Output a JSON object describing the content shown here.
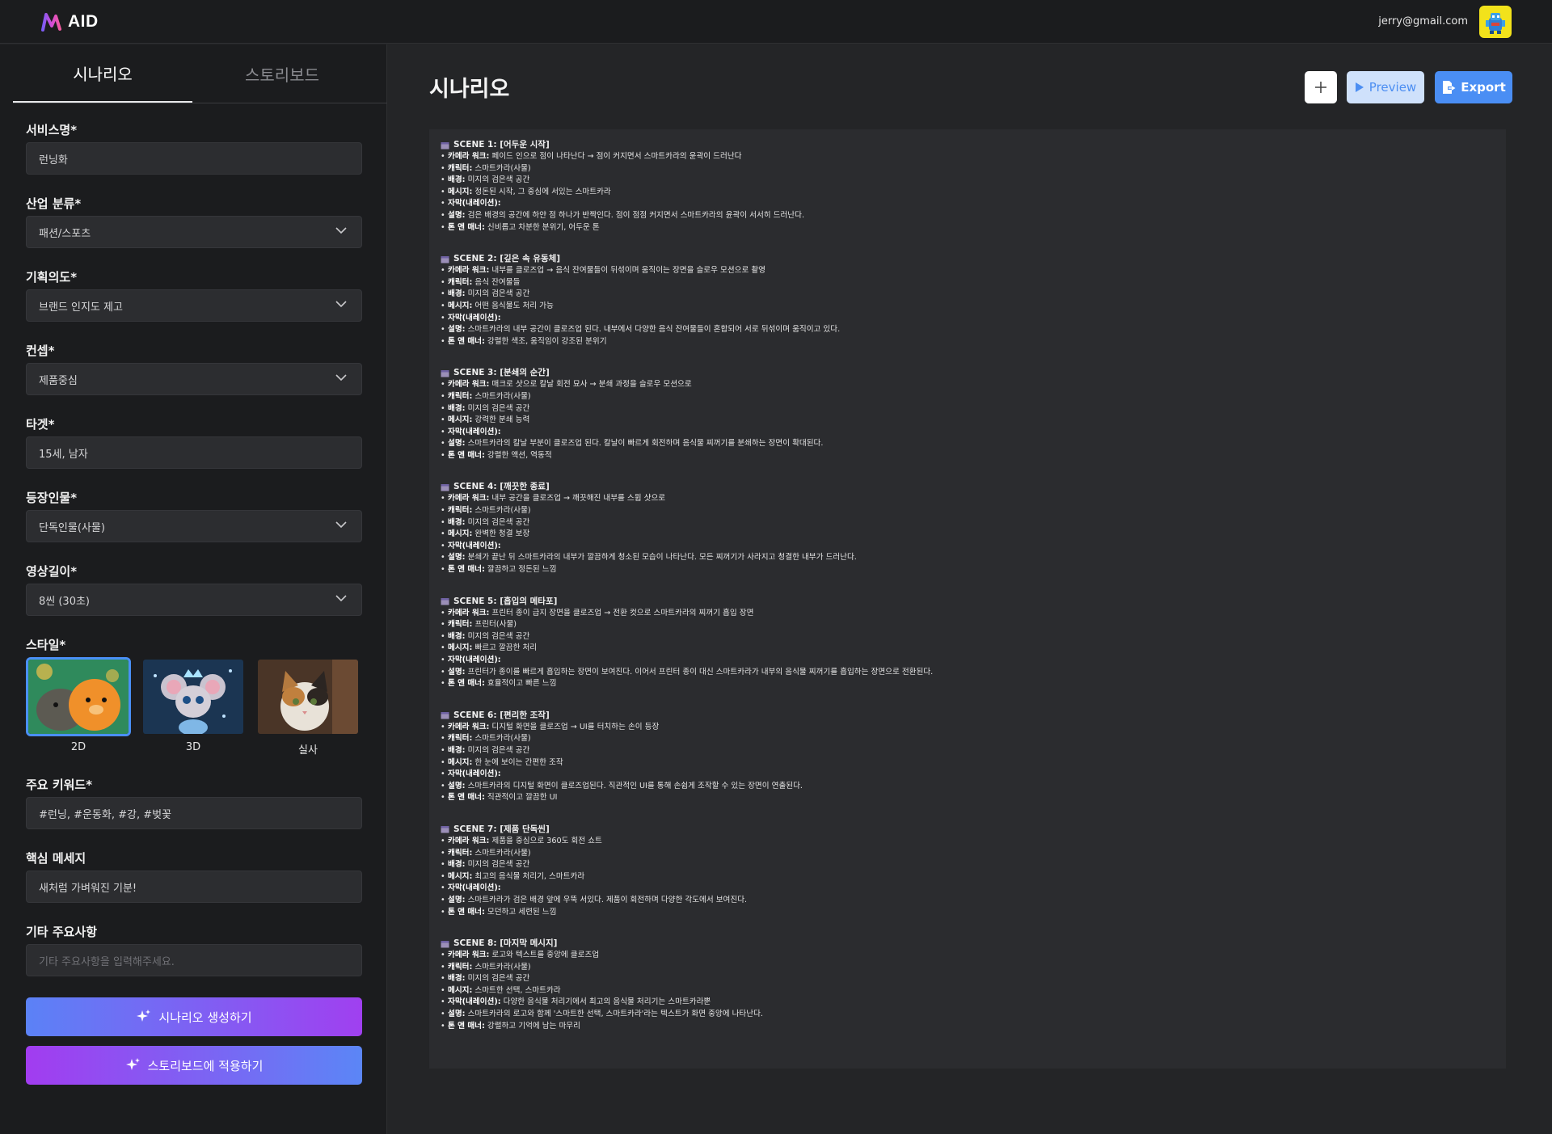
{
  "app": {
    "logo_text": "AID"
  },
  "user": {
    "email": "jerry@gmail.com"
  },
  "sidebar": {
    "tabs": [
      {
        "label": "시나리오"
      },
      {
        "label": "스토리보드"
      }
    ],
    "fields": {
      "service_name": {
        "label": "서비스명*",
        "value": "런닝화"
      },
      "industry": {
        "label": "산업 분류*",
        "value": "패션/스포츠"
      },
      "intent": {
        "label": "기획의도*",
        "value": "브랜드 인지도 제고"
      },
      "concept": {
        "label": "컨셉*",
        "value": "제품중심"
      },
      "target": {
        "label": "타겟*",
        "value": "15세, 남자"
      },
      "characters": {
        "label": "등장인물*",
        "value": "단독인물(사물)"
      },
      "length": {
        "label": "영상길이*",
        "value": "8씬 (30초)"
      },
      "style": {
        "label": "스타일*",
        "options": [
          "2D",
          "3D",
          "실사"
        ],
        "selected": "2D"
      },
      "keywords": {
        "label": "주요 키워드*",
        "value": "#런닝, #운동화, #강, #벚꽃"
      },
      "message": {
        "label": "핵심 메세지",
        "value": "새처럼 가벼워진 기분!"
      },
      "etc": {
        "label": "기타 주요사항",
        "placeholder": "기타 주요사항을 입력해주세요."
      }
    },
    "buttons": {
      "generate": "시나리오 생성하기",
      "apply": "스토리보드에 적용하기"
    }
  },
  "main": {
    "title": "시나리오",
    "buttons": {
      "preview": "Preview",
      "export": "Export"
    },
    "field_labels": {
      "camera": "카메라 워크:",
      "character": "캐릭터:",
      "background": "배경:",
      "message": "메시지:",
      "narration": "자막(내레이션):",
      "description": "설명:",
      "tone": "톤 앤 매너:"
    },
    "scenes": [
      {
        "title": "SCENE 1: [어두운 시작]",
        "camera": "페이드 인으로 점이 나타난다 → 점이 커지면서 스마트카라의 윤곽이 드러난다",
        "character": "스마트카라(사물)",
        "background": "미지의 검은색 공간",
        "message": "정돈된 시작, 그 중심에 서있는 스마트카라",
        "narration": "",
        "description": "검은 배경의 공간에 하얀 점 하나가 반짝인다. 점이 점점 커지면서 스마트카라의 윤곽이 서서히 드러난다.",
        "tone": "신비롭고 차분한 분위기, 어두운 톤"
      },
      {
        "title": "SCENE 2: [깊은 속 유동체]",
        "camera": "내부를 클로즈업 → 음식 잔여물들이 뒤섞이며 움직이는 장면을 슬로우 모션으로 촬영",
        "character": "음식 잔여물들",
        "background": "미지의 검은색 공간",
        "message": "어떤 음식물도 처리 가능",
        "narration": "",
        "description": "스마트카라의 내부 공간이 클로즈업 된다. 내부에서 다양한 음식 잔여물들이 혼합되어 서로 뒤섞이며 움직이고 있다.",
        "tone": "강렬한 색조, 움직임이 강조된 분위기"
      },
      {
        "title": "SCENE 3: [분쇄의 순간]",
        "camera": "매크로 샷으로 칼날 회전 묘사 → 분쇄 과정을 슬로우 모션으로",
        "character": "스마트카라(사물)",
        "background": "미지의 검은색 공간",
        "message": "강력한 분쇄 능력",
        "narration": "",
        "description": "스마트카라의 칼날 부분이 클로즈업 된다. 칼날이 빠르게 회전하며 음식물 찌꺼기를 분쇄하는 장면이 확대된다.",
        "tone": "강렬한 액션, 역동적"
      },
      {
        "title": "SCENE 4: [깨끗한 종료]",
        "camera": "내부 공간을 클로즈업 → 깨끗해진 내부를 스윕 샷으로",
        "character": "스마트카라(사물)",
        "background": "미지의 검은색 공간",
        "message": "완벽한 청결 보장",
        "narration": "",
        "description": "분쇄가 끝난 뒤 스마트카라의 내부가 깔끔하게 청소된 모습이 나타난다. 모든 찌꺼기가 사라지고 청결한 내부가 드러난다.",
        "tone": "깔끔하고 정돈된 느낌"
      },
      {
        "title": "SCENE 5: [흡입의 메타포]",
        "camera": "프린터 종이 급지 장면을 클로즈업 → 전환 컷으로 스마트카라의 찌꺼기 흡입 장면",
        "character": "프린터(사물)",
        "background": "미지의 검은색 공간",
        "message": "빠르고 깔끔한 처리",
        "narration": "",
        "description": "프린터가 종이를 빠르게 흡입하는 장면이 보여진다. 이어서 프린터 종이 대신 스마트카라가 내부의 음식물 찌꺼기를 흡입하는 장면으로 전환된다.",
        "tone": "효율적이고 빠른 느낌"
      },
      {
        "title": "SCENE 6: [편리한 조작]",
        "camera": "디지털 화면을 클로즈업 → UI를 터치하는 손이 등장",
        "character": "스마트카라(사물)",
        "background": "미지의 검은색 공간",
        "message": "한 눈에 보이는 간편한 조작",
        "narration": "",
        "description": "스마트카라의 디지털 화면이 클로즈업된다. 직관적인 UI를 통해 손쉽게 조작할 수 있는 장면이 연출된다.",
        "tone": "직관적이고 깔끔한 UI"
      },
      {
        "title": "SCENE 7: [제품 단독씬]",
        "camera": "제품을 중심으로 360도 회전 쇼트",
        "character": "스마트카라(사물)",
        "background": "미지의 검은색 공간",
        "message": "최고의 음식물 처리기, 스마트카라",
        "narration": "",
        "description": "스마트카라가 검은 배경 앞에 우뚝 서있다. 제품이 회전하며 다양한 각도에서 보여진다.",
        "tone": "모던하고 세련된 느낌"
      },
      {
        "title": "SCENE 8: [마지막 메시지]",
        "camera": "로고와 텍스트를 중앙에 클로즈업",
        "character": "스마트카라(사물)",
        "background": "미지의 검은색 공간",
        "message": "스마트한 선택, 스마트카라",
        "narration": "다양한 음식물 처리기에서 최고의 음식물 처리기는 스마트카라뿐",
        "description": "스마트카라의 로고와 함께 '스마트한 선택, 스마트카라'라는 텍스트가 화면 중앙에 나타난다.",
        "tone": "강렬하고 기억에 남는 마무리"
      }
    ]
  },
  "colors": {
    "accent": "#4a8ef4",
    "selected_border": "#4a8ff5",
    "gradient_blue": "#5b82f6",
    "gradient_purple": "#a040f0"
  }
}
